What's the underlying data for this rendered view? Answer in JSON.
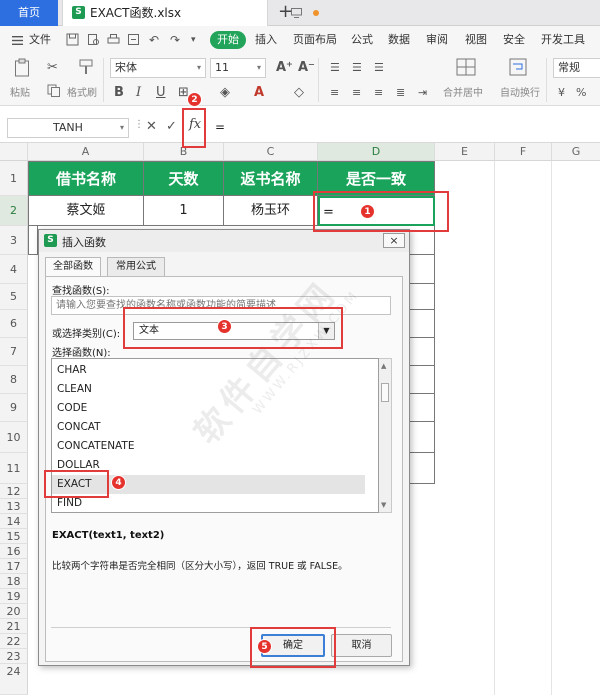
{
  "tabs": {
    "home": "首页",
    "file": "EXACT函数.xlsx"
  },
  "menu": {
    "file": "文件",
    "start": "开始",
    "insert": "插入",
    "layout": "页面布局",
    "formula": "公式",
    "data": "数据",
    "review": "审阅",
    "view": "视图",
    "security": "安全",
    "devtools": "开发工具"
  },
  "ribbon": {
    "paste": "粘贴",
    "format_painter": "格式刷",
    "font_name": "宋体",
    "font_size": "11",
    "merge_center": "合并居中",
    "wrap_text": "自动换行",
    "number_format": "常规"
  },
  "formula_bar": {
    "name_box": "TANH",
    "fx": "fx",
    "content": "="
  },
  "columns": [
    "A",
    "B",
    "C",
    "D",
    "E",
    "F",
    "G"
  ],
  "rows": [
    "1",
    "2",
    "3",
    "4",
    "5",
    "6",
    "7",
    "8",
    "9",
    "10",
    "11",
    "12",
    "13",
    "14",
    "15",
    "16",
    "17",
    "18",
    "19",
    "20",
    "21",
    "22",
    "23",
    "24"
  ],
  "sheet": {
    "headers": [
      "借书名称",
      "天数",
      "返书名称",
      "是否一致"
    ],
    "row2": [
      "蔡文姬",
      "1",
      "杨玉环",
      "="
    ]
  },
  "dialog": {
    "title": "插入函数",
    "close": "×",
    "tab_all": "全部函数",
    "tab_common": "常用公式",
    "search_label": "查找函数(S):",
    "search_placeholder": "请输入您要查找的函数名称或函数功能的简要描述",
    "category_label": "或选择类别(C):",
    "category_value": "文本",
    "select_label": "选择函数(N):",
    "functions": [
      "CHAR",
      "CLEAN",
      "CODE",
      "CONCAT",
      "CONCATENATE",
      "DOLLAR",
      "EXACT",
      "FIND"
    ],
    "selected": "EXACT",
    "signature": "EXACT(text1, text2)",
    "description": "比较两个字符串是否完全相同（区分大小写），返回 TRUE 或 FALSE。",
    "ok": "确定",
    "cancel": "取消"
  },
  "annotations": [
    "1",
    "2",
    "3",
    "4",
    "5"
  ],
  "watermark": {
    "main": "软件自学网",
    "sub": "WWW.RJZXW.COM"
  },
  "colors": {
    "header_green": "#1aa35a",
    "brand_blue": "#2d6ee0",
    "annotation_red": "#e23b3b"
  }
}
